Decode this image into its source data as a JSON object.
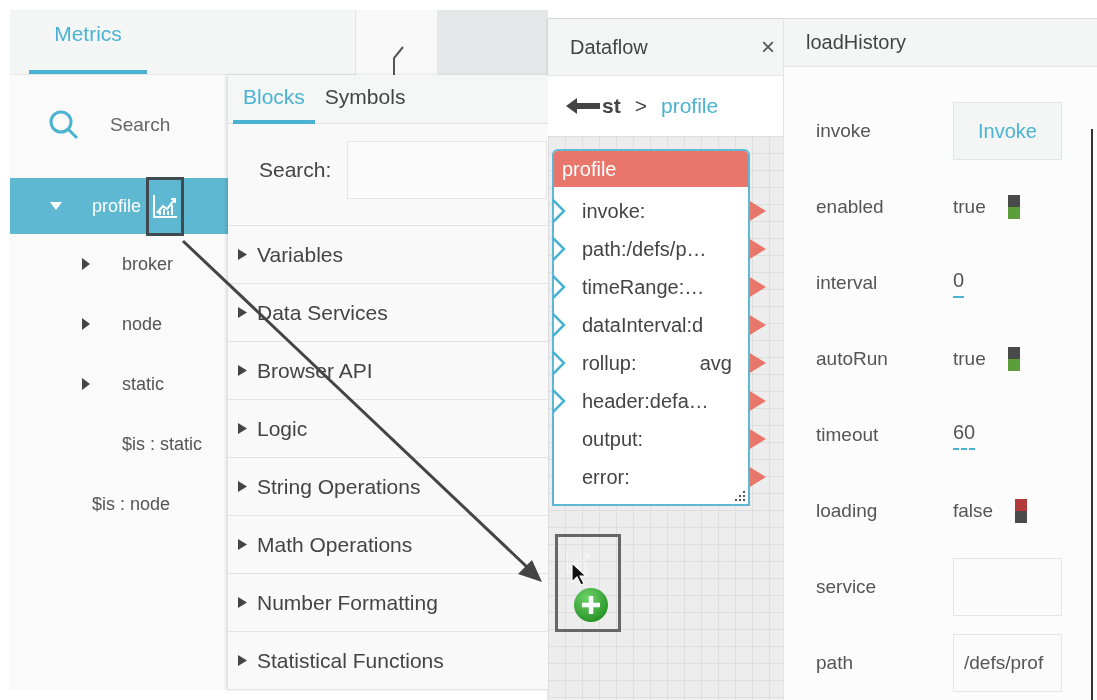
{
  "left_panel": {
    "tabs": [
      {
        "label": "Metrics",
        "selected": true
      }
    ],
    "search": {
      "placeholder": "Search"
    },
    "tree": [
      {
        "label": "profile",
        "selected": true,
        "expanded": true,
        "children": [
          {
            "label": "broker",
            "selected": false,
            "expanded": false
          },
          {
            "label": "node",
            "selected": false,
            "expanded": false
          },
          {
            "label": "static",
            "selected": false,
            "expanded": false
          },
          {
            "label": "$is : static",
            "selected": false
          }
        ]
      },
      {
        "label": "$is : node",
        "selected": false
      }
    ]
  },
  "blocks_panel": {
    "tabs": [
      {
        "label": "Blocks",
        "selected": true
      },
      {
        "label": "Symbols",
        "selected": false
      }
    ],
    "search_label": "Search:",
    "categories": [
      "Variables",
      "Data Services",
      "Browser API",
      "Logic",
      "String Operations",
      "Math Operations",
      "Number Formatting",
      "Statistical Functions"
    ]
  },
  "dataflow": {
    "tab": {
      "title": "Dataflow",
      "close": "×"
    },
    "breadcrumb": {
      "back": "st",
      "separator": ">",
      "current": "profile"
    },
    "block": {
      "title": "profile",
      "ports": [
        {
          "label": "invoke:",
          "input": true
        },
        {
          "label": "path:/defs/p…",
          "input": true
        },
        {
          "label": "timeRange:…",
          "input": true
        },
        {
          "label": "dataInterval:d",
          "input": true
        },
        {
          "label": "rollup:",
          "value": "avg",
          "input": true
        },
        {
          "label": "header:defa…",
          "input": true
        },
        {
          "label": "output:",
          "input": false
        },
        {
          "label": "error:",
          "input": false
        }
      ]
    }
  },
  "properties": {
    "title": "loadHistory",
    "rows": [
      {
        "name": "invoke",
        "kind": "button",
        "value": "Invoke"
      },
      {
        "name": "enabled",
        "kind": "toggle",
        "value": "true",
        "on": true
      },
      {
        "name": "interval",
        "kind": "number",
        "value": "0"
      },
      {
        "name": "autoRun",
        "kind": "toggle",
        "value": "true",
        "on": true
      },
      {
        "name": "timeout",
        "kind": "number",
        "value": "60"
      },
      {
        "name": "loading",
        "kind": "toggle",
        "value": "false",
        "on": false
      },
      {
        "name": "service",
        "kind": "field"
      },
      {
        "name": "path",
        "kind": "field",
        "value": "/defs/prof"
      }
    ]
  }
}
